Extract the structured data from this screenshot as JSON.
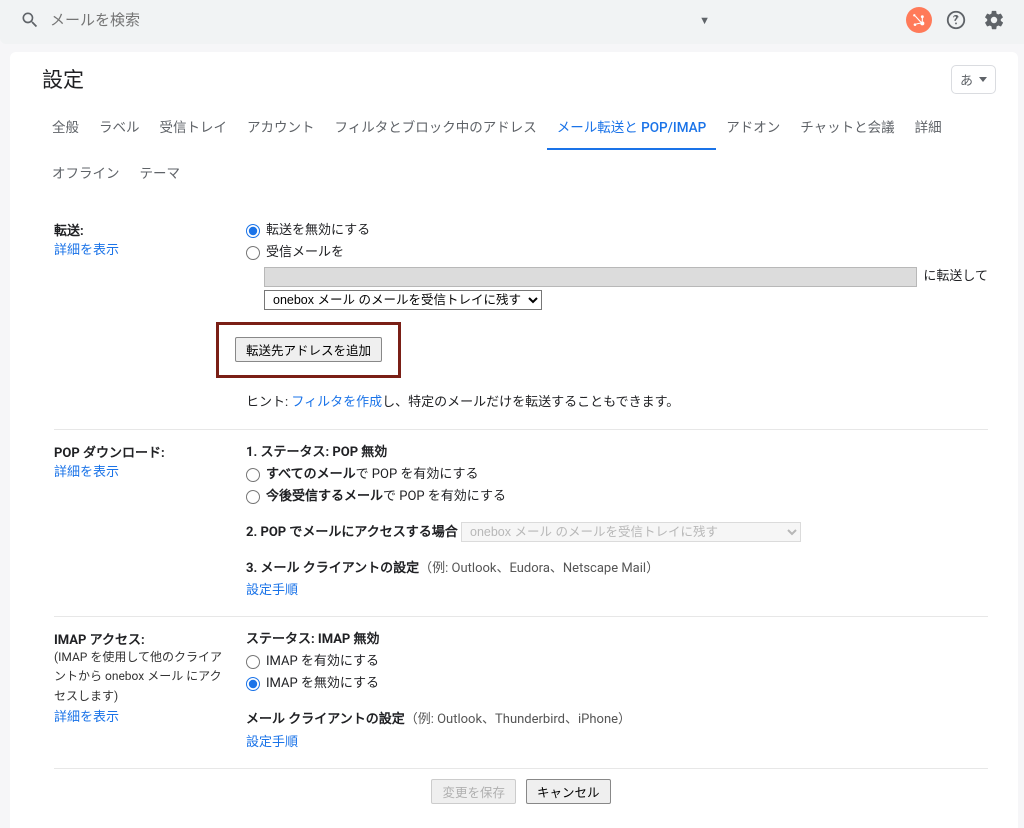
{
  "search": {
    "placeholder": "メールを検索"
  },
  "header": {
    "title": "設定",
    "lang": "あ"
  },
  "tabs": {
    "items": [
      "全般",
      "ラベル",
      "受信トレイ",
      "アカウント",
      "フィルタとブロック中のアドレス",
      "メール転送と POP/IMAP",
      "アドオン",
      "チャットと会議",
      "詳細",
      "オフライン",
      "テーマ"
    ]
  },
  "forwarding": {
    "heading": "転送:",
    "learn_more": "詳細を表示",
    "opt_disable": "転送を無効にする",
    "opt_forward_prefix": "受信メールを",
    "forward_suffix_left": "に転送して",
    "keep_select": "onebox メール のメールを受信トレイに残す",
    "add_button": "転送先アドレスを追加",
    "hint_prefix": "ヒント: ",
    "hint_link": "フィルタを作成",
    "hint_suffix": "し、特定のメールだけを転送することもできます。"
  },
  "pop": {
    "heading": "POP ダウンロード:",
    "learn_more": "詳細を表示",
    "status_label": "1. ステータス: POP 無効",
    "opt_all_pre": "すべてのメール",
    "opt_all_post": "で POP を有効にする",
    "opt_future_pre": "今後受信するメール",
    "opt_future_post": "で POP を有効にする",
    "access_label": "2. POP でメールにアクセスする場合",
    "access_select": "onebox メール のメールを受信トレイに残す",
    "client_label": "3. メール クライアントの設定",
    "client_examples": "（例: Outlook、Eudora、Netscape Mail）",
    "instructions": "設定手順"
  },
  "imap": {
    "heading": "IMAP アクセス:",
    "subnote": "(IMAP を使用して他のクライアントから onebox メール にアクセスします)",
    "learn_more": "詳細を表示",
    "status_label": "ステータス: IMAP 無効",
    "opt_enable": "IMAP を有効にする",
    "opt_disable": "IMAP を無効にする",
    "client_label": "メール クライアントの設定",
    "client_examples": "（例: Outlook、Thunderbird、iPhone）",
    "instructions": "設定手順"
  },
  "footer": {
    "save": "変更を保存",
    "cancel": "キャンセル"
  }
}
